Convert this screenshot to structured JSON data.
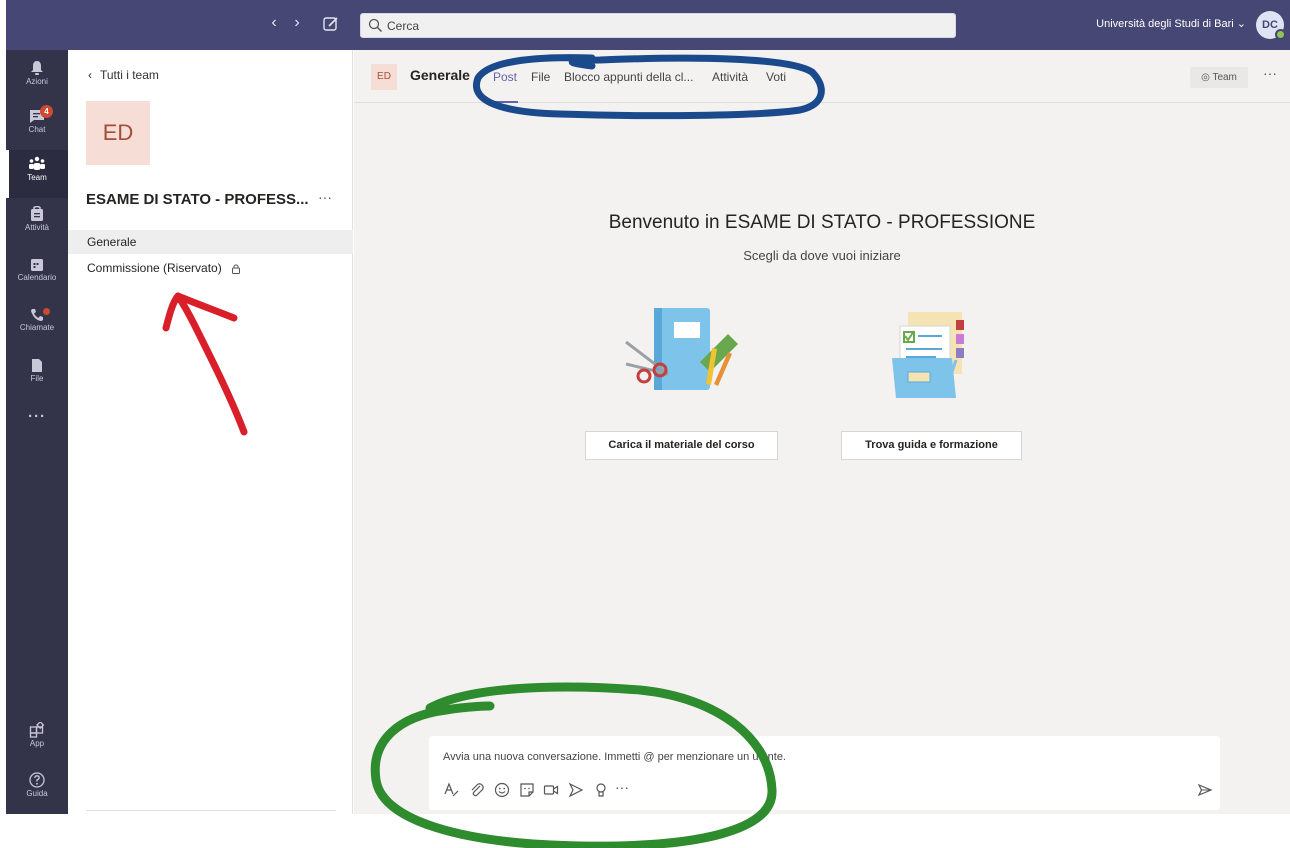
{
  "topbar": {
    "search_placeholder": "Cerca",
    "organization": "Università degli Studi di Bari ⌄",
    "user_initials": "DC"
  },
  "rail": {
    "items": [
      {
        "label": "Azioni",
        "icon": "bell-icon"
      },
      {
        "label": "Chat",
        "icon": "chat-icon",
        "badge": "4"
      },
      {
        "label": "Team",
        "icon": "teams-icon",
        "active": true
      },
      {
        "label": "Attività",
        "icon": "assignments-icon"
      },
      {
        "label": "Calendario",
        "icon": "calendar-icon"
      },
      {
        "label": "Chiamate",
        "icon": "phone-icon"
      },
      {
        "label": "File",
        "icon": "file-icon"
      },
      {
        "label": "···",
        "icon": "more-icon"
      }
    ],
    "bottom": [
      {
        "label": "App",
        "icon": "apps-icon"
      },
      {
        "label": "Guida",
        "icon": "help-icon"
      }
    ]
  },
  "sidebar": {
    "back_label": "Tutti i team",
    "team_initials": "ED",
    "team_name": "ESAME DI STATO - PROFESS...",
    "more": "···",
    "channels": [
      {
        "label": "Generale",
        "active": true
      },
      {
        "label": "Commissione (Riservato)",
        "locked": true
      }
    ]
  },
  "header": {
    "avatar": "ED",
    "channel": "Generale",
    "tabs": [
      "Post",
      "File",
      "Blocco appunti della cl...",
      "Attività",
      "Voti"
    ],
    "active_tab": "Post",
    "team_button": "Team",
    "more": "···"
  },
  "welcome": {
    "title": "Benvenuto in ESAME DI STATO - PROFESSIONE",
    "subtitle": "Scegli da dove vuoi iniziare",
    "cards": [
      {
        "label": "Carica il materiale del corso",
        "illustration": "notebook-scissors-illustration"
      },
      {
        "label": "Trova guida e formazione",
        "illustration": "folder-documents-illustration"
      }
    ]
  },
  "compose": {
    "placeholder": "Avvia una nuova conversazione. Immetti @ per menzionare un utente.",
    "tools": [
      "format-icon",
      "attach-icon",
      "emoji-icon",
      "sticker-icon",
      "meet-icon",
      "stream-icon",
      "praise-icon",
      "more-icon"
    ],
    "more": "···"
  },
  "colors": {
    "topbar": "#464775",
    "rail": "#33344a",
    "accent": "#6264a7",
    "annotation_red": "#d81f2a",
    "annotation_blue": "#1b4a8c",
    "annotation_green": "#2e8b2e"
  }
}
